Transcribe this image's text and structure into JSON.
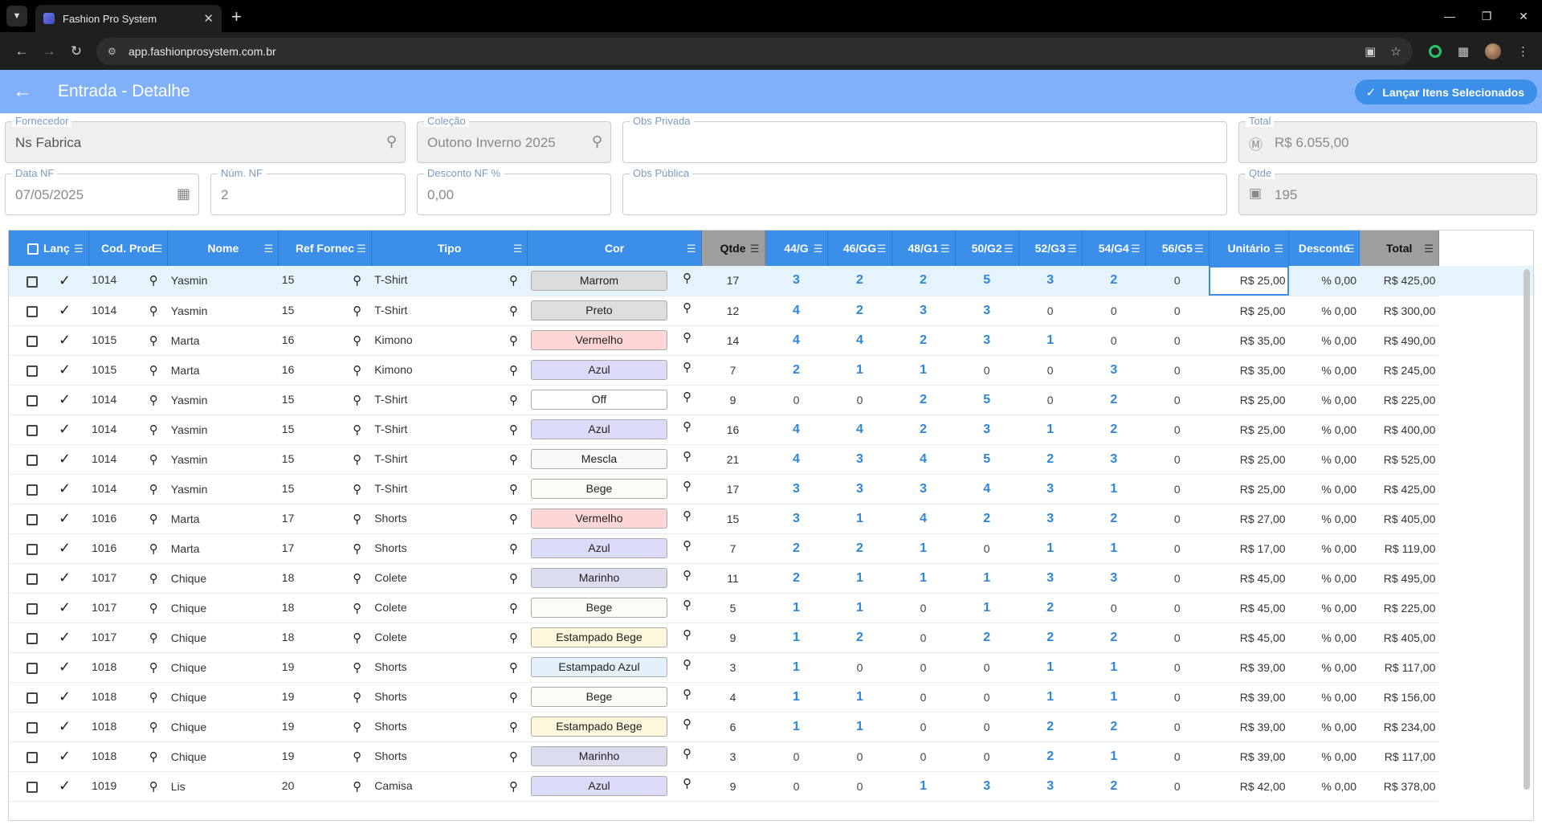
{
  "browser": {
    "tab_title": "Fashion Pro System",
    "url": "app.fashionprosystem.com.br"
  },
  "header": {
    "title": "Entrada - Detalhe",
    "action_label": "Lançar Itens Selecionados"
  },
  "form": {
    "fornecedor": {
      "label": "Fornecedor",
      "value": "Ns Fabrica"
    },
    "colecao": {
      "label": "Coleção",
      "value": "Outono  Inverno 2025"
    },
    "obs_privada": {
      "label": "Obs Privada",
      "value": ""
    },
    "total": {
      "label": "Total",
      "value": "R$ 6.055,00"
    },
    "data_nf": {
      "label": "Data NF",
      "value": "07/05/2025"
    },
    "num_nf": {
      "label": "Núm. NF",
      "value": "2"
    },
    "desconto_nf": {
      "label": "Desconto NF %",
      "value": "0,00"
    },
    "obs_publica": {
      "label": "Obs Pública",
      "value": ""
    },
    "qtde": {
      "label": "Qtde",
      "value": "195"
    }
  },
  "grid": {
    "columns": [
      "Lanç",
      "Cod. Prod",
      "Nome",
      "Ref Fornec",
      "Tipo",
      "Cor",
      "Qtde",
      "44/G",
      "46/GG",
      "48/G1",
      "50/G2",
      "52/G3",
      "54/G4",
      "56/G5",
      "Unitário",
      "Desconto",
      "Total"
    ],
    "rows": [
      {
        "cod": "1014",
        "nome": "Yasmin",
        "ref": "15",
        "tipo": "T-Shirt",
        "cor": "Marrom",
        "cor_bg": "#dcdcdc",
        "qtde": "17",
        "sizes": [
          "3",
          "2",
          "2",
          "5",
          "3",
          "2",
          "0"
        ],
        "unit": "R$ 25,00",
        "desc": "% 0,00",
        "total": "R$ 425,00"
      },
      {
        "cod": "1014",
        "nome": "Yasmin",
        "ref": "15",
        "tipo": "T-Shirt",
        "cor": "Preto",
        "cor_bg": "#dedede",
        "qtde": "12",
        "sizes": [
          "4",
          "2",
          "3",
          "3",
          "0",
          "0",
          "0"
        ],
        "unit": "R$ 25,00",
        "desc": "% 0,00",
        "total": "R$ 300,00"
      },
      {
        "cod": "1015",
        "nome": "Marta",
        "ref": "16",
        "tipo": "Kimono",
        "cor": "Vermelho",
        "cor_bg": "#ffd6d6",
        "qtde": "14",
        "sizes": [
          "4",
          "4",
          "2",
          "3",
          "1",
          "0",
          "0"
        ],
        "unit": "R$ 35,00",
        "desc": "% 0,00",
        "total": "R$ 490,00"
      },
      {
        "cod": "1015",
        "nome": "Marta",
        "ref": "16",
        "tipo": "Kimono",
        "cor": "Azul",
        "cor_bg": "#dcdcfa",
        "qtde": "7",
        "sizes": [
          "2",
          "1",
          "1",
          "0",
          "0",
          "3",
          "0"
        ],
        "unit": "R$ 35,00",
        "desc": "% 0,00",
        "total": "R$ 245,00"
      },
      {
        "cod": "1014",
        "nome": "Yasmin",
        "ref": "15",
        "tipo": "T-Shirt",
        "cor": "Off",
        "cor_bg": "#ffffff",
        "qtde": "9",
        "sizes": [
          "0",
          "0",
          "2",
          "5",
          "0",
          "2",
          "0"
        ],
        "unit": "R$ 25,00",
        "desc": "% 0,00",
        "total": "R$ 225,00"
      },
      {
        "cod": "1014",
        "nome": "Yasmin",
        "ref": "15",
        "tipo": "T-Shirt",
        "cor": "Azul",
        "cor_bg": "#dcdcfa",
        "qtde": "16",
        "sizes": [
          "4",
          "4",
          "2",
          "3",
          "1",
          "2",
          "0"
        ],
        "unit": "R$ 25,00",
        "desc": "% 0,00",
        "total": "R$ 400,00"
      },
      {
        "cod": "1014",
        "nome": "Yasmin",
        "ref": "15",
        "tipo": "T-Shirt",
        "cor": "Mescla",
        "cor_bg": "#f8f8f8",
        "qtde": "21",
        "sizes": [
          "4",
          "3",
          "4",
          "5",
          "2",
          "3",
          "0"
        ],
        "unit": "R$ 25,00",
        "desc": "% 0,00",
        "total": "R$ 525,00"
      },
      {
        "cod": "1014",
        "nome": "Yasmin",
        "ref": "15",
        "tipo": "T-Shirt",
        "cor": "Bege",
        "cor_bg": "#fdfbf6",
        "qtde": "17",
        "sizes": [
          "3",
          "3",
          "3",
          "4",
          "3",
          "1",
          "0"
        ],
        "unit": "R$ 25,00",
        "desc": "% 0,00",
        "total": "R$ 425,00"
      },
      {
        "cod": "1016",
        "nome": "Marta",
        "ref": "17",
        "tipo": "Shorts",
        "cor": "Vermelho",
        "cor_bg": "#ffd6d6",
        "qtde": "15",
        "sizes": [
          "3",
          "1",
          "4",
          "2",
          "3",
          "2",
          "0"
        ],
        "unit": "R$ 27,00",
        "desc": "% 0,00",
        "total": "R$ 405,00"
      },
      {
        "cod": "1016",
        "nome": "Marta",
        "ref": "17",
        "tipo": "Shorts",
        "cor": "Azul",
        "cor_bg": "#dcdcfa",
        "qtde": "7",
        "sizes": [
          "2",
          "2",
          "1",
          "0",
          "1",
          "1",
          "0"
        ],
        "unit": "R$ 17,00",
        "desc": "% 0,00",
        "total": "R$ 119,00"
      },
      {
        "cod": "1017",
        "nome": "Chique",
        "ref": "18",
        "tipo": "Colete",
        "cor": "Marinho",
        "cor_bg": "#dcdcf0",
        "qtde": "11",
        "sizes": [
          "2",
          "1",
          "1",
          "1",
          "3",
          "3",
          "0"
        ],
        "unit": "R$ 45,00",
        "desc": "% 0,00",
        "total": "R$ 495,00"
      },
      {
        "cod": "1017",
        "nome": "Chique",
        "ref": "18",
        "tipo": "Colete",
        "cor": "Bege",
        "cor_bg": "#fdfbf6",
        "qtde": "5",
        "sizes": [
          "1",
          "1",
          "0",
          "1",
          "2",
          "0",
          "0"
        ],
        "unit": "R$ 45,00",
        "desc": "% 0,00",
        "total": "R$ 225,00"
      },
      {
        "cod": "1017",
        "nome": "Chique",
        "ref": "18",
        "tipo": "Colete",
        "cor": "Estampado Bege",
        "cor_bg": "#fdf7dc",
        "qtde": "9",
        "sizes": [
          "1",
          "2",
          "0",
          "2",
          "2",
          "2",
          "0"
        ],
        "unit": "R$ 45,00",
        "desc": "% 0,00",
        "total": "R$ 405,00"
      },
      {
        "cod": "1018",
        "nome": "Chique",
        "ref": "19",
        "tipo": "Shorts",
        "cor": "Estampado Azul",
        "cor_bg": "#e4f1fb",
        "qtde": "3",
        "sizes": [
          "1",
          "0",
          "0",
          "0",
          "1",
          "1",
          "0"
        ],
        "unit": "R$ 39,00",
        "desc": "% 0,00",
        "total": "R$ 117,00"
      },
      {
        "cod": "1018",
        "nome": "Chique",
        "ref": "19",
        "tipo": "Shorts",
        "cor": "Bege",
        "cor_bg": "#fdfbf6",
        "qtde": "4",
        "sizes": [
          "1",
          "1",
          "0",
          "0",
          "1",
          "1",
          "0"
        ],
        "unit": "R$ 39,00",
        "desc": "% 0,00",
        "total": "R$ 156,00"
      },
      {
        "cod": "1018",
        "nome": "Chique",
        "ref": "19",
        "tipo": "Shorts",
        "cor": "Estampado Bege",
        "cor_bg": "#fdf7dc",
        "qtde": "6",
        "sizes": [
          "1",
          "1",
          "0",
          "0",
          "2",
          "2",
          "0"
        ],
        "unit": "R$ 39,00",
        "desc": "% 0,00",
        "total": "R$ 234,00"
      },
      {
        "cod": "1018",
        "nome": "Chique",
        "ref": "19",
        "tipo": "Shorts",
        "cor": "Marinho",
        "cor_bg": "#dcdcf0",
        "qtde": "3",
        "sizes": [
          "0",
          "0",
          "0",
          "0",
          "2",
          "1",
          "0"
        ],
        "unit": "R$ 39,00",
        "desc": "% 0,00",
        "total": "R$ 117,00"
      },
      {
        "cod": "1019",
        "nome": "Lis",
        "ref": "20",
        "tipo": "Camisa",
        "cor": "Azul",
        "cor_bg": "#dcdcfa",
        "qtde": "9",
        "sizes": [
          "0",
          "0",
          "1",
          "3",
          "3",
          "2",
          "0"
        ],
        "unit": "R$ 42,00",
        "desc": "% 0,00",
        "total": "R$ 378,00"
      }
    ]
  }
}
